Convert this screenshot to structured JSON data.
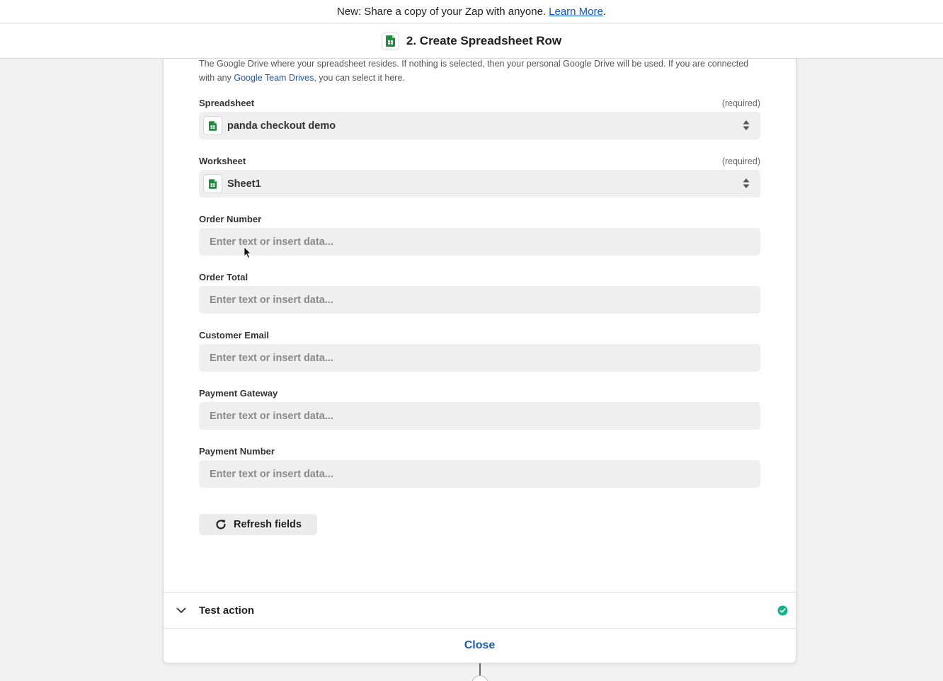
{
  "announcement": {
    "text": "New: Share a copy of your Zap with anyone.",
    "link": "Learn More",
    "trailing": "."
  },
  "header": {
    "title": "2. Create Spreadsheet Row",
    "icon": "google-sheets-icon"
  },
  "help": {
    "text_before": "The Google Drive where your spreadsheet resides. If nothing is selected, then your personal Google Drive will be used. If you are connected with any ",
    "link": "Google Team Drives",
    "text_after": ", you can select it here."
  },
  "fields": {
    "spreadsheet": {
      "label": "Spreadsheet",
      "required": "(required)",
      "value": "panda checkout demo"
    },
    "worksheet": {
      "label": "Worksheet",
      "required": "(required)",
      "value": "Sheet1"
    },
    "order_number": {
      "label": "Order Number",
      "placeholder": "Enter text or insert data..."
    },
    "order_total": {
      "label": "Order Total",
      "placeholder": "Enter text or insert data..."
    },
    "customer_email": {
      "label": "Customer Email",
      "placeholder": "Enter text or insert data..."
    },
    "payment_gateway": {
      "label": "Payment Gateway",
      "placeholder": "Enter text or insert data..."
    },
    "payment_number": {
      "label": "Payment Number",
      "placeholder": "Enter text or insert data..."
    }
  },
  "refresh_label": "Refresh fields",
  "test_action": {
    "label": "Test action",
    "status": "complete"
  },
  "close_label": "Close",
  "colors": {
    "link": "#1c5ab5",
    "sheets_green": "#1e8e3e",
    "success_teal": "#13b08c"
  }
}
